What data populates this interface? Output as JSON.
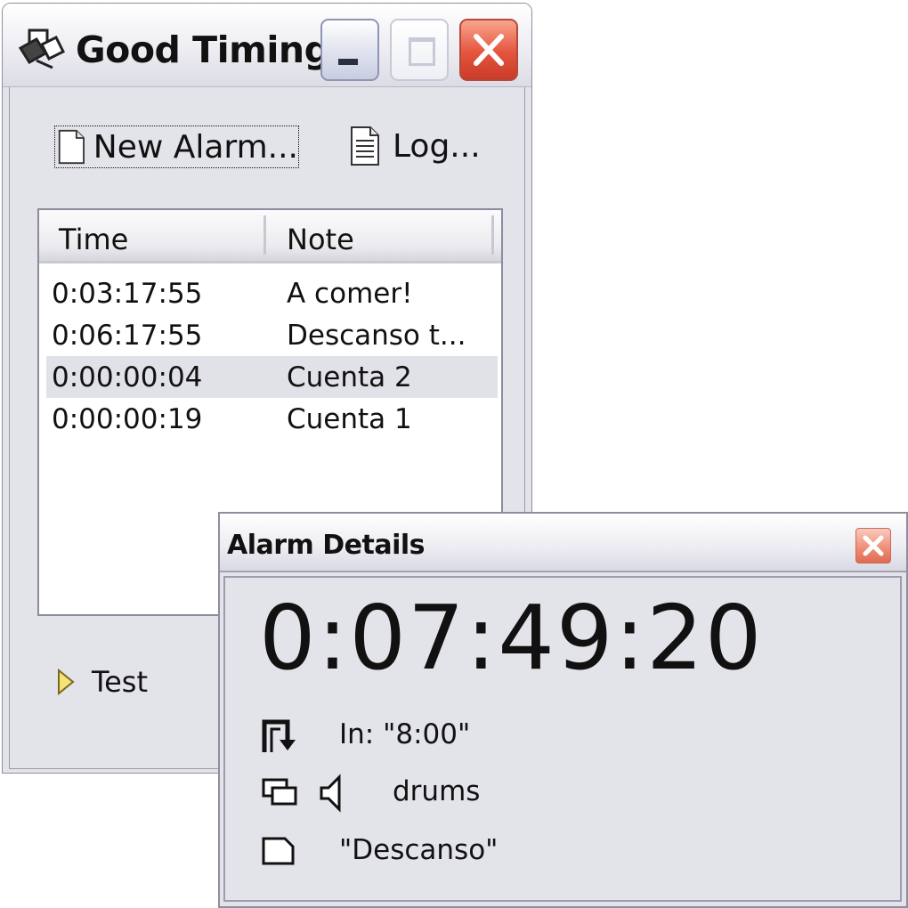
{
  "main_window": {
    "title": "Good Timing",
    "toolbar": {
      "new_alarm_label": "New Alarm...",
      "log_label": "Log..."
    },
    "list": {
      "columns": [
        "Time",
        "Note"
      ],
      "rows": [
        {
          "time": "0:03:17:55",
          "note": "A comer!"
        },
        {
          "time": "0:06:17:55",
          "note": "Descanso t..."
        },
        {
          "time": "0:00:00:04",
          "note": "Cuenta 2"
        },
        {
          "time": "0:00:00:19",
          "note": "Cuenta 1"
        }
      ],
      "selected_index": 2
    },
    "footer": {
      "test_label": "Test"
    }
  },
  "alarm_details": {
    "title": "Alarm Details",
    "countdown": "0:07:49:20",
    "trigger_text": "In: \"8:00\"",
    "sound_text": "drums",
    "note_text": "\"Descanso\""
  },
  "colors": {
    "window_bg": "#e3e3ea",
    "close_red": "#e5543d",
    "selected_row": "#e1e1e8"
  }
}
